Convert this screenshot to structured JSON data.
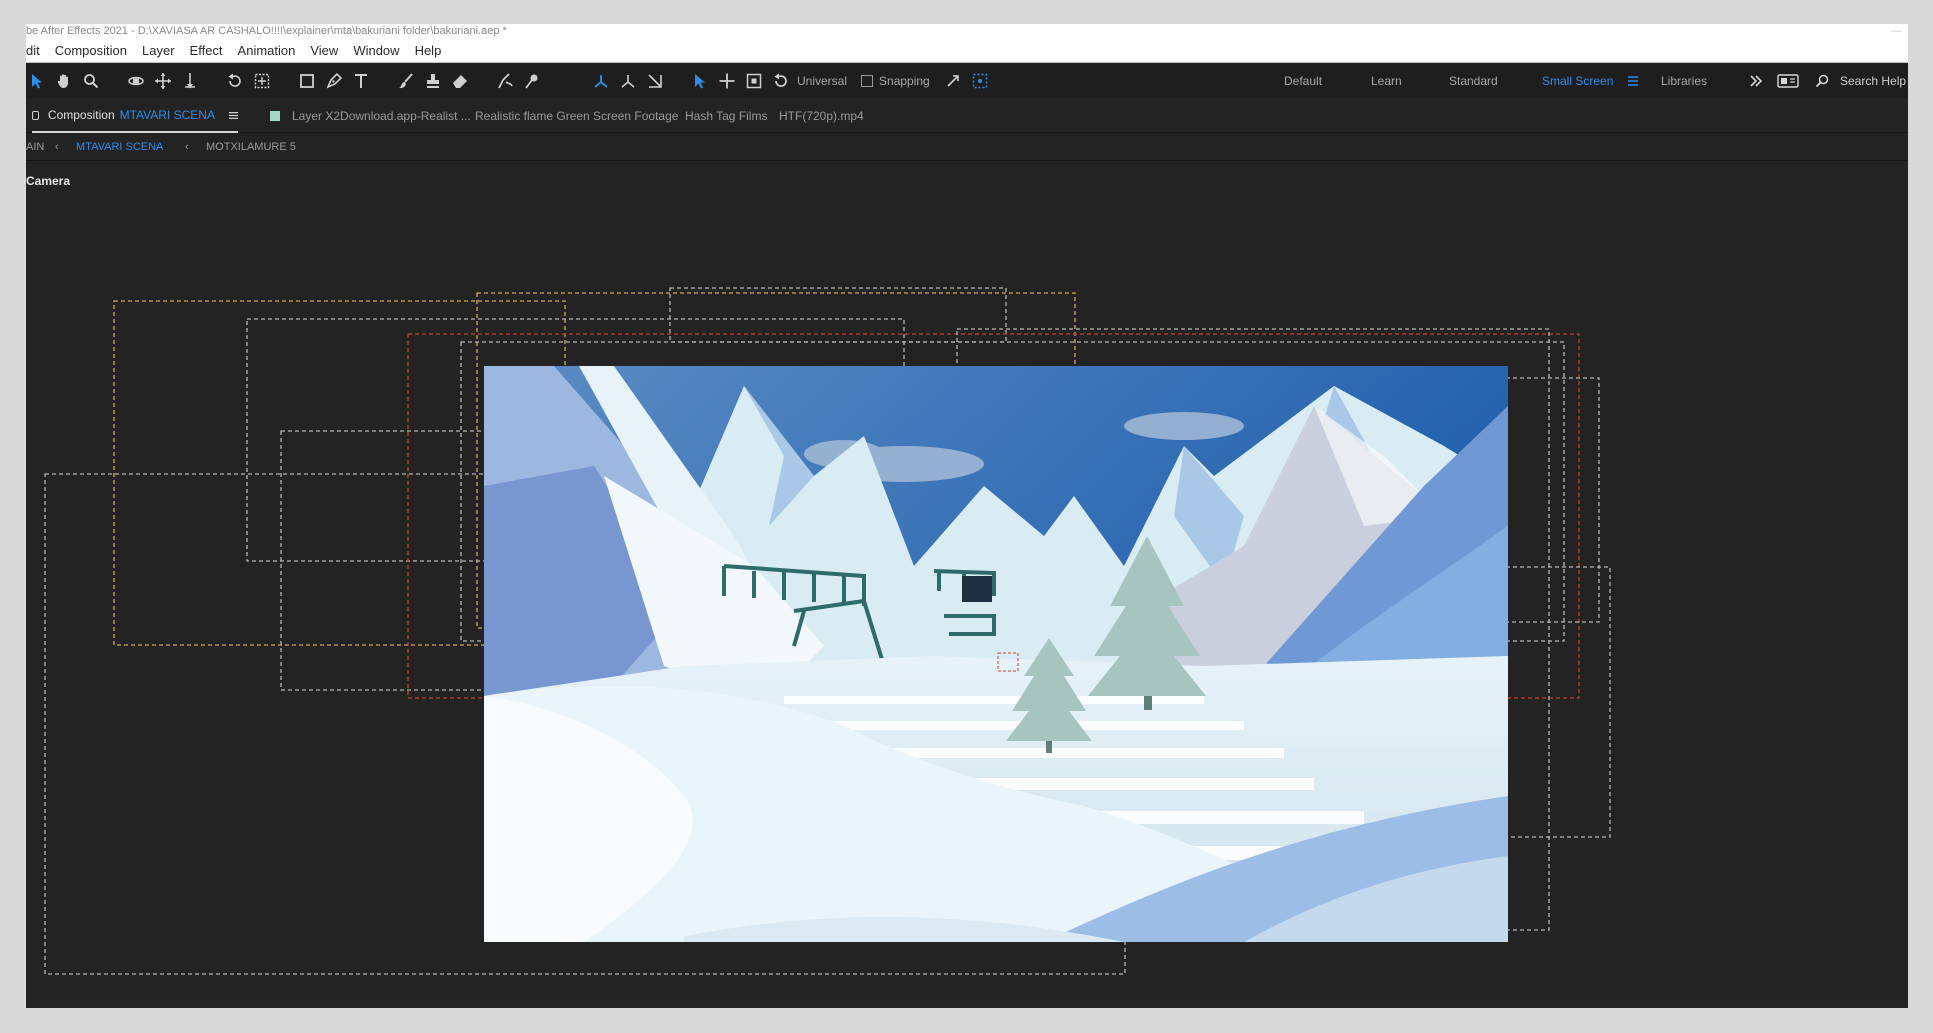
{
  "window": {
    "title": "be After Effects 2021 - D:\\XAVIASA AR CASHALO!!!!\\explainer\\mta\\bakuriani folder\\bakuriani.aep *"
  },
  "menu": [
    "dit",
    "Composition",
    "Layer",
    "Effect",
    "Animation",
    "View",
    "Window",
    "Help"
  ],
  "toolbar": {
    "axis_mode": "Universal",
    "snapping_label": "Snapping",
    "snapping_checked": false,
    "tools": [
      "selection-tool",
      "hand-tool",
      "zoom-tool",
      "orbit-camera-tool",
      "pan-camera-tool",
      "dolly-camera-tool",
      "rotate-tool",
      "pan-behind-tool",
      "rectangle-tool",
      "pen-tool",
      "type-tool",
      "brush-tool",
      "clone-stamp-tool",
      "eraser-tool",
      "roto-brush-tool",
      "puppet-pin-tool"
    ]
  },
  "workspaces": {
    "items": [
      "Default",
      "Learn",
      "Standard",
      "Small Screen",
      "Libraries"
    ],
    "active": "Small Screen",
    "search_label": "Search Help"
  },
  "panel_tabs": {
    "composition_prefix": "Composition",
    "composition_name": "MTAVARI SCENA",
    "layer_tab": "Layer  X2Download.app-Realist ...",
    "footage_tabs": [
      "Realistic flame Green Screen Footage",
      "Hash Tag Films",
      "HTF(720p).mp4"
    ]
  },
  "breadcrumbs": {
    "items": [
      "AIN",
      "MTAVARI SCENA",
      "MOTXILAMURE 5"
    ],
    "active": "MTAVARI SCENA"
  },
  "viewer": {
    "camera_label": "Camera",
    "outline_colors": {
      "yellow": "#c9b24a",
      "red": "#c0432f",
      "gray": "#b5b5b5"
    }
  },
  "colors": {
    "accent": "#2d8ceb",
    "panel": "#232323",
    "toolbar": "#1e1e1e"
  }
}
